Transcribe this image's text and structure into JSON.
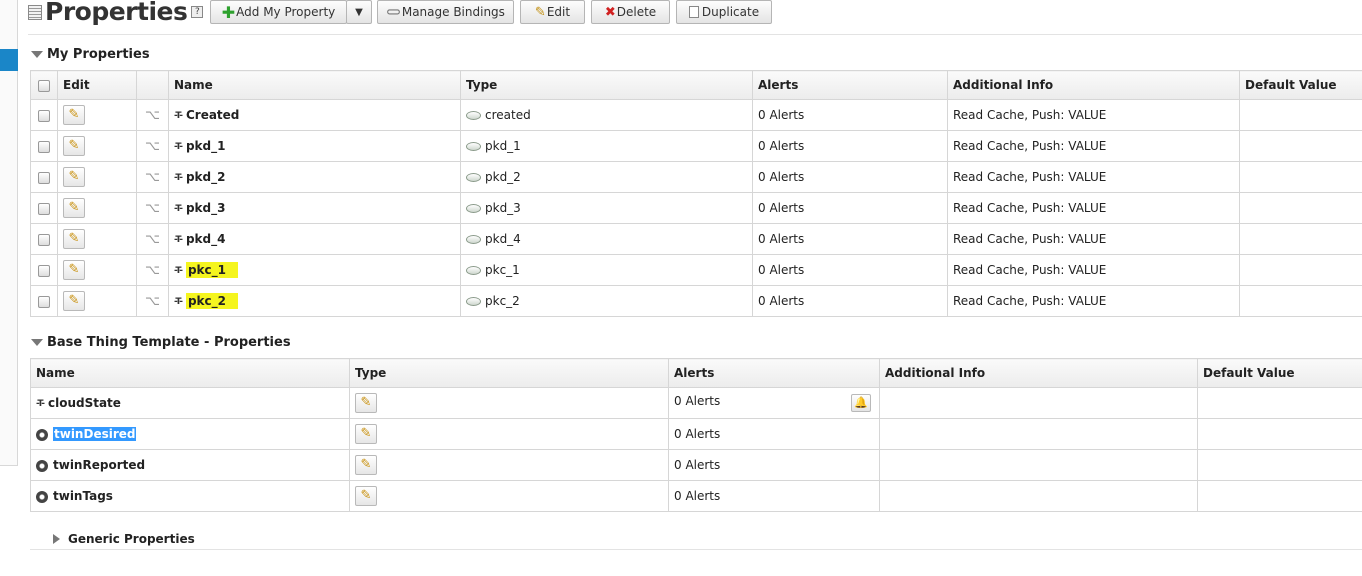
{
  "header": {
    "title": "Properties",
    "help": "?",
    "buttons": {
      "add": "Add My Property",
      "manage": "Manage Bindings",
      "edit": "Edit",
      "delete": "Delete",
      "duplicate": "Duplicate"
    }
  },
  "my_properties": {
    "title": "My Properties",
    "columns": [
      "Edit",
      "Name",
      "Type",
      "Alerts",
      "Additional Info",
      "Default Value"
    ],
    "rows": [
      {
        "name": "Created",
        "type": "created",
        "alerts": "0 Alerts",
        "info": "Read Cache, Push: VALUE",
        "default": ""
      },
      {
        "name": "pkd_1",
        "type": "pkd_1",
        "alerts": "0 Alerts",
        "info": "Read Cache, Push: VALUE",
        "default": ""
      },
      {
        "name": "pkd_2",
        "type": "pkd_2",
        "alerts": "0 Alerts",
        "info": "Read Cache, Push: VALUE",
        "default": ""
      },
      {
        "name": "pkd_3",
        "type": "pkd_3",
        "alerts": "0 Alerts",
        "info": "Read Cache, Push: VALUE",
        "default": ""
      },
      {
        "name": "pkd_4",
        "type": "pkd_4",
        "alerts": "0 Alerts",
        "info": "Read Cache, Push: VALUE",
        "default": ""
      },
      {
        "name": "pkc_1",
        "type": "pkc_1",
        "alerts": "0 Alerts",
        "info": "Read Cache, Push: VALUE",
        "default": ""
      },
      {
        "name": "pkc_2",
        "type": "pkc_2",
        "alerts": "0 Alerts",
        "info": "Read Cache, Push: VALUE",
        "default": ""
      }
    ]
  },
  "base_props": {
    "title": "Base Thing Template - Properties",
    "columns": [
      "Name",
      "Type",
      "Alerts",
      "Additional Info",
      "Default Value"
    ],
    "rows": [
      {
        "name": "cloudState",
        "alerts": "0 Alerts"
      },
      {
        "name": "twinDesired",
        "alerts": "0 Alerts"
      },
      {
        "name": "twinReported",
        "alerts": "0 Alerts"
      },
      {
        "name": "twinTags",
        "alerts": "0 Alerts"
      }
    ]
  },
  "generic": {
    "title": "Generic Properties"
  },
  "icons": {
    "string_type": "string-type-icon",
    "json_type": "json-type-icon",
    "datashape": "datashape-icon",
    "binding": "binding-icon",
    "edit": "pencil-icon",
    "alert": "bell-icon"
  },
  "colors": {
    "highlight": "#f5f51f",
    "selection": "#3399ff",
    "rail_accent": "#1a86c8"
  }
}
